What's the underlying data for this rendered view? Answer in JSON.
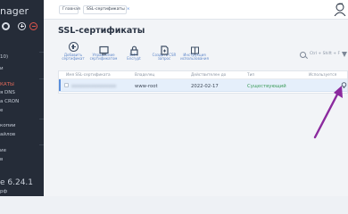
{
  "app": {
    "logo_text": "nager",
    "version": "e 6.24.1"
  },
  "sidebar": {
    "items": [
      {
        "label": "10)"
      },
      {
        "label": "и"
      },
      {
        "label": "КАТЫ",
        "active": true
      },
      {
        "label": "я DNS"
      },
      {
        "label": "а CRON"
      },
      {
        "label": "е"
      },
      {
        "label": "копии"
      },
      {
        "label": "айлов"
      },
      {
        "label": "ие"
      },
      {
        "label": "в"
      },
      {
        "label": "рф"
      }
    ]
  },
  "breadcrumb": {
    "home_label": "Главная",
    "current_label": "SSL-сертификаты",
    "close_glyph": "×"
  },
  "page": {
    "title": "SSL-сертификаты"
  },
  "toolbar": {
    "buttons": [
      {
        "label_1": "Добавить",
        "label_2": "сертификат",
        "icon": "add-icon"
      },
      {
        "label_1": "Управление",
        "label_2": "сертификатом",
        "icon": "manage-icon"
      },
      {
        "label_1": "Let's",
        "label_2": "Encrypt",
        "icon": "lock-icon"
      },
      {
        "label_1": "Создать CSR",
        "label_2": "запрос",
        "icon": "csr-icon"
      },
      {
        "label_1": "Инструкция",
        "label_2": "использования",
        "icon": "instruction-icon"
      }
    ],
    "search_placeholder": "Ctrl + Shift + F"
  },
  "table": {
    "columns": [
      "Имя SSL-сертификата",
      "Владелец",
      "Действителен до",
      "Тип",
      "Используется"
    ],
    "rows": [
      {
        "name": "xxxxxxxxxxxxxxxx",
        "owner": "www-root",
        "valid_until": "2022-02-17",
        "type": "Существующий",
        "in_use_icon": "lightbulb-icon"
      }
    ]
  },
  "colors": {
    "sidebar_bg": "#252c38",
    "accent_blue": "#5b8fdc",
    "status_green": "#3b9c5a",
    "arrow_purple": "#8b2a9e"
  }
}
